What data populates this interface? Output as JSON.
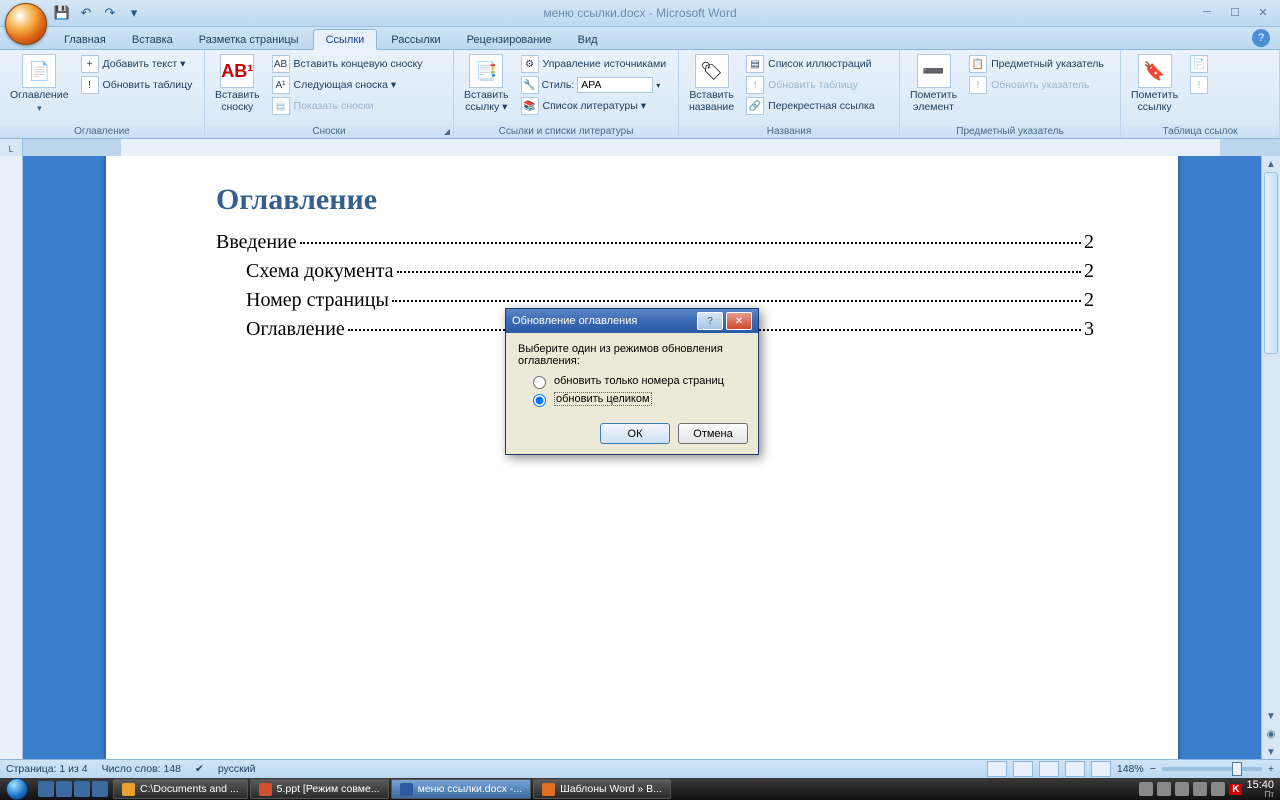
{
  "title": "меню ссылки.docx - Microsoft Word",
  "qat": {
    "save": "💾",
    "undo": "↶",
    "redo": "↷",
    "more": "▾"
  },
  "tabs": [
    "Главная",
    "Вставка",
    "Разметка страницы",
    "Ссылки",
    "Рассылки",
    "Рецензирование",
    "Вид"
  ],
  "active_tab": 3,
  "ribbon": {
    "g1": {
      "label": "Оглавление",
      "big": "Оглавление",
      "add_text": "Добавить текст ▾",
      "update": "Обновить таблицу"
    },
    "g2": {
      "label": "Сноски",
      "big": "Вставить\nсноску",
      "ab": "AB¹",
      "end": "Вставить концевую сноску",
      "next": "Следующая сноска ▾",
      "show": "Показать сноски"
    },
    "g3": {
      "label": "Ссылки и списки литературы",
      "big": "Вставить\nссылку ▾",
      "manage": "Управление источниками",
      "style_label": "Стиль:",
      "style_value": "APA",
      "list": "Список литературы ▾"
    },
    "g4": {
      "label": "Названия",
      "big": "Вставить\nназвание",
      "figlist": "Список иллюстраций",
      "update": "Обновить таблицу",
      "cross": "Перекрестная ссылка"
    },
    "g5": {
      "label": "Предметный указатель",
      "big": "Пометить\nэлемент",
      "index": "Предметный указатель",
      "update": "Обновить указатель"
    },
    "g6": {
      "label": "Таблица ссылок",
      "big": "Пометить\nссылку"
    }
  },
  "document": {
    "heading": "Оглавление",
    "toc": [
      {
        "text": "Введение",
        "page": "2",
        "indent": false
      },
      {
        "text": "Схема документа",
        "page": "2",
        "indent": true
      },
      {
        "text": "Номер страницы",
        "page": "2",
        "indent": true
      },
      {
        "text": "Оглавление",
        "page": "3",
        "indent": true
      }
    ]
  },
  "dialog": {
    "title": "Обновление оглавления",
    "prompt": "Выберите один из режимов обновления оглавления:",
    "opt1": "обновить только номера страниц",
    "opt2": "обновить целиком",
    "ok": "ОК",
    "cancel": "Отмена"
  },
  "status": {
    "page": "Страница: 1 из 4",
    "words": "Число слов: 148",
    "lang": "русский",
    "zoom": "148%"
  },
  "taskbar": {
    "items": [
      {
        "label": "C:\\Documents and ...",
        "active": false
      },
      {
        "label": "5.ppt [Режим совме...",
        "active": false
      },
      {
        "label": "меню ссылки.docx -...",
        "active": true
      },
      {
        "label": "Шаблоны Word » В...",
        "active": false
      }
    ],
    "time": "15:40",
    "day": "Пт"
  }
}
